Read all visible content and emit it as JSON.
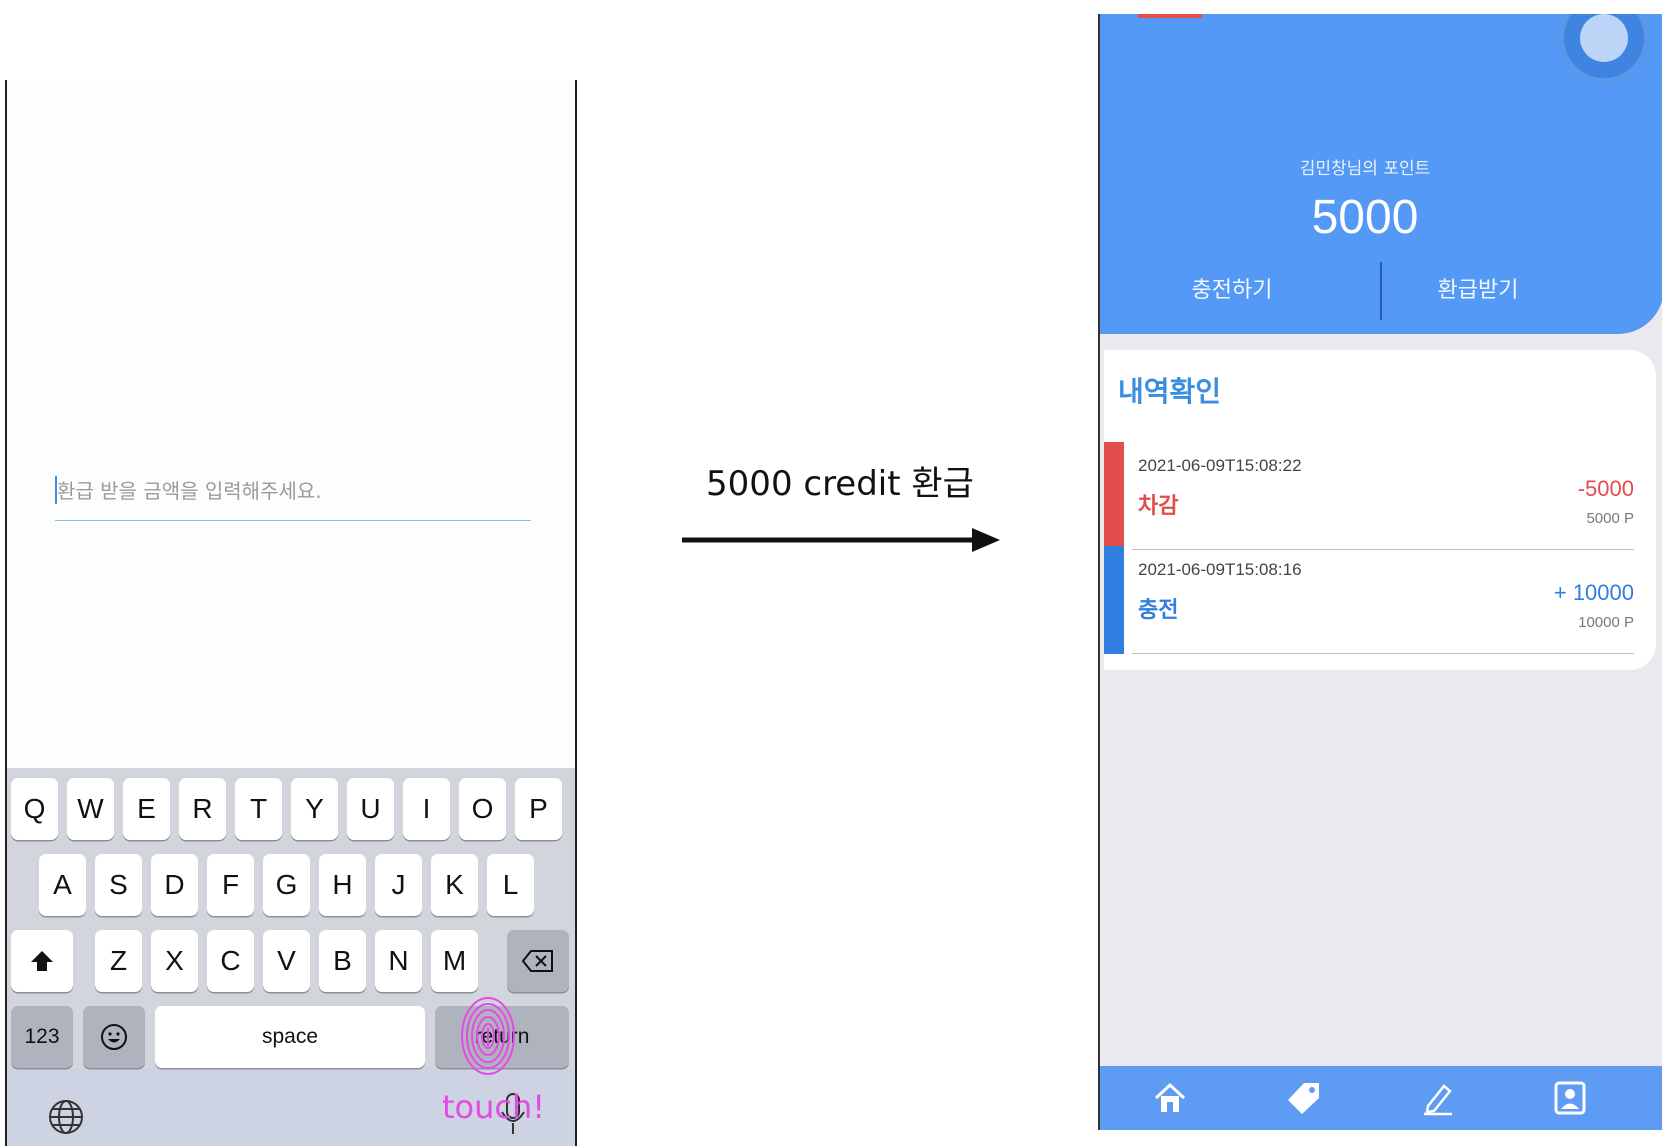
{
  "transition": {
    "caption": "5000 credit 환급"
  },
  "left_screen": {
    "amount_input": {
      "placeholder": "환급 받을 금액을 입력해주세요.",
      "value": ""
    },
    "keyboard": {
      "row1": [
        "Q",
        "W",
        "E",
        "R",
        "T",
        "Y",
        "U",
        "I",
        "O",
        "P"
      ],
      "row2": [
        "A",
        "S",
        "D",
        "F",
        "G",
        "H",
        "J",
        "K",
        "L"
      ],
      "row3": [
        "Z",
        "X",
        "C",
        "V",
        "B",
        "N",
        "M"
      ],
      "numbers_key": "123",
      "space_key": "space",
      "return_key": "return",
      "icons": [
        "shift-icon",
        "backspace-icon",
        "emoji-icon",
        "globe-icon",
        "microphone-icon"
      ]
    },
    "touch_overlay": {
      "label": "touch!",
      "icon": "fingerprint-icon",
      "color": "#e44be6"
    }
  },
  "right_screen": {
    "header": {
      "owner_label": "김민창님의 포인트",
      "points": "5000",
      "charge_label": "충전하기",
      "refund_label": "환급받기"
    },
    "history": {
      "title": "내역확인",
      "items": [
        {
          "timestamp": "2021-06-09T15:08:22",
          "type": "차감",
          "amount": "-5000",
          "balance": "5000 P",
          "color": "#e24d4d"
        },
        {
          "timestamp": "2021-06-09T15:08:16",
          "type": "충전",
          "amount": "+ 10000",
          "balance": "10000 P",
          "color": "#2f7ee0"
        }
      ]
    },
    "bottom_nav": {
      "icons": [
        "home-icon",
        "tag-icon",
        "pencil-icon",
        "profile-icon"
      ]
    },
    "colors": {
      "header": "#5499f5",
      "accent": "#3a8de0",
      "debit": "#e24d4d"
    }
  }
}
